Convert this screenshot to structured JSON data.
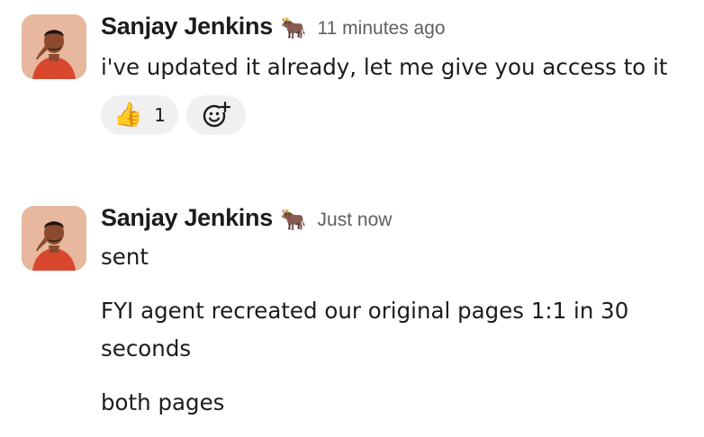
{
  "messages": [
    {
      "author": "Sanjay Jenkins",
      "status_emoji": "🐂",
      "timestamp": "11 minutes ago",
      "body": [
        "i've updated it already, let me give you access to it"
      ],
      "reactions": [
        {
          "emoji": "👍",
          "count": "1"
        }
      ],
      "add_reaction_icon": "add-emoji-icon"
    },
    {
      "author": "Sanjay Jenkins",
      "status_emoji": "🐂",
      "timestamp": "Just now",
      "body": [
        "sent",
        "FYI agent recreated our original pages 1:1 in 30 seconds",
        "both pages"
      ]
    }
  ]
}
